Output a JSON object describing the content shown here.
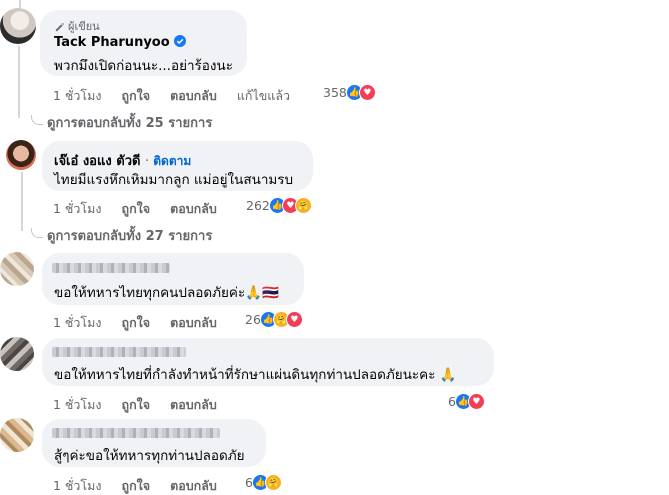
{
  "comments": [
    {
      "badge": "ผู้เขียน",
      "author": "Tack Pharunyoo",
      "verified": true,
      "text": "พวกมึงเปิดก่อนนะ...อย่าร้องนะ",
      "time": "1 ชั่วโมง",
      "like": "ถูกใจ",
      "reply": "ตอบกลับ",
      "edited": "แก้ไขแล้ว",
      "reaction_count": "358",
      "reactions": [
        "like-icon",
        "love-icon"
      ],
      "view_replies": "ดูการตอบกลับทั้ง 25 รายการ"
    },
    {
      "author": "เจ๊เอ๋ งอแง ตัวดี",
      "follow": "ติดตาม",
      "text": "ไทยมีแรงหึกเหิมมากลูก แม่อยู่ในสนามรบ",
      "time": "1 ชั่วโมง",
      "like": "ถูกใจ",
      "reply": "ตอบกลับ",
      "reaction_count": "262",
      "reactions": [
        "like-icon",
        "love-icon",
        "care-icon"
      ],
      "view_replies": "ดูการตอบกลับทั้ง 27 รายการ"
    },
    {
      "text": "ขอให้ทหารไทยทุกคนปลอดภัยค่ะ🙏🇹🇭",
      "time": "1 ชั่วโมง",
      "like": "ถูกใจ",
      "reply": "ตอบกลับ",
      "reaction_count": "26",
      "reactions": [
        "like-icon",
        "care-icon",
        "love-icon"
      ]
    },
    {
      "text": "ขอให้ทหารไทยที่กำลังทำหน้าที่รักษาแผ่นดินทุกท่านปลอดภัยนะคะ 🙏",
      "time": "1 ชั่วโมง",
      "like": "ถูกใจ",
      "reply": "ตอบกลับ",
      "reaction_count": "6",
      "reactions": [
        "like-icon",
        "love-icon"
      ]
    },
    {
      "text": "สู้ๆค่ะขอให้ทหารทุกท่านปลอดภัย",
      "time": "1 ชั่วโมง",
      "like": "ถูกใจ",
      "reply": "ตอบกลับ",
      "reaction_count": "6",
      "reactions": [
        "like-icon",
        "care-icon"
      ]
    }
  ],
  "colors": {
    "bubble": "#f0f2f5",
    "meta": "#65676b",
    "link": "#0064d1",
    "like": "#1877f2",
    "love": "#f33e58"
  }
}
